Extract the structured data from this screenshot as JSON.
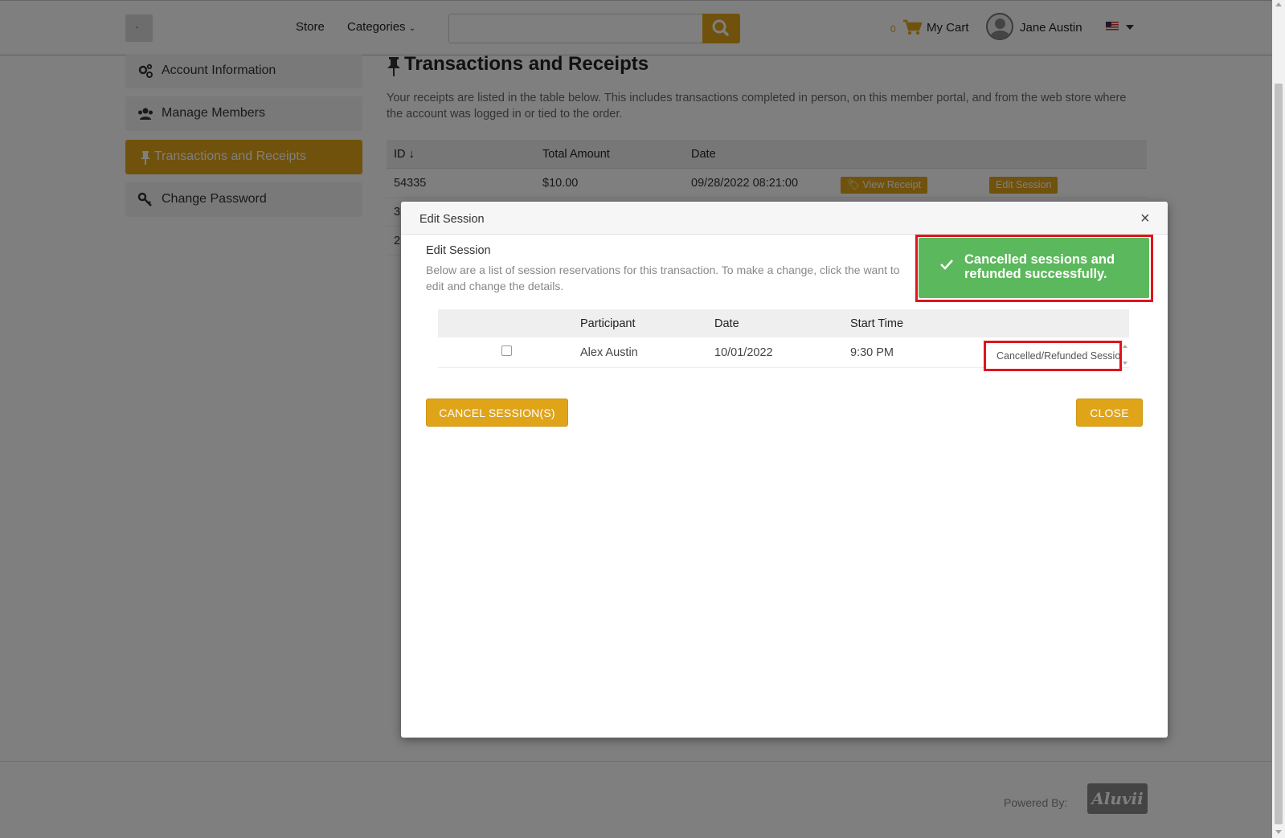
{
  "nav": {
    "store": "Store",
    "categories": "Categories",
    "search_placeholder": "",
    "cart_count": "0",
    "cart_label": "My Cart",
    "user_name": "Jane Austin"
  },
  "sidebar": {
    "items": [
      {
        "label": "Account Information",
        "icon": "gears-icon"
      },
      {
        "label": "Manage Members",
        "icon": "users-icon"
      },
      {
        "label": "Transactions and Receipts",
        "icon": "pin-icon",
        "active": true
      },
      {
        "label": "Change Password",
        "icon": "key-icon"
      }
    ]
  },
  "main": {
    "title": "Transactions and Receipts",
    "description": "Your receipts are listed in the table below. This includes transactions completed in person, on this member portal, and from the web store where the account was logged in or tied to the order.",
    "columns": [
      "ID ↓",
      "Total Amount",
      "Date"
    ],
    "rows": [
      {
        "id": "54335",
        "amount": "$10.00",
        "date": "09/28/2022 08:21:00",
        "view_label": "View Receipt",
        "edit_label": "Edit Session"
      }
    ],
    "partial_ids": [
      "3",
      "2"
    ]
  },
  "modal": {
    "title": "Edit Session",
    "subtitle": "Edit Session",
    "description": "Below are a list of session reservations for this transaction. To make a change, click the want to edit and change the details.",
    "columns": [
      "Participant",
      "Date",
      "Start Time"
    ],
    "rows": [
      {
        "participant": "Alex Austin",
        "date": "10/01/2022",
        "start_time": "9:30 PM",
        "status": "Cancelled/Refunded Session",
        "checked": false
      }
    ],
    "cancel_button": "CANCEL SESSION(S)",
    "close_button": "CLOSE",
    "close_x": "×"
  },
  "toast": {
    "message": "Cancelled sessions and refunded successfully.",
    "color": "#5cb85c"
  },
  "footer": {
    "powered_by": "Powered By:",
    "brand": "Aluvii"
  },
  "colors": {
    "accent": "#e0a419",
    "highlight": "#e0141c"
  }
}
